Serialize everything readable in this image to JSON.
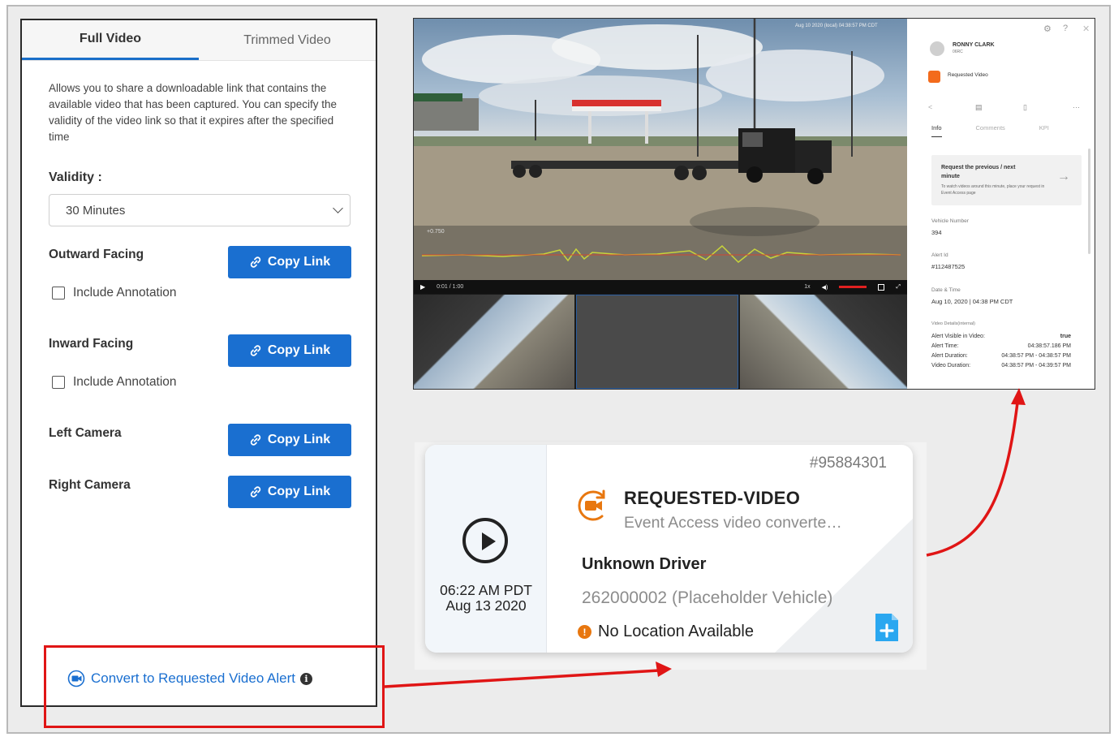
{
  "share_panel": {
    "tabs": [
      {
        "label": "Full Video",
        "active": true
      },
      {
        "label": "Trimmed Video",
        "active": false
      }
    ],
    "description": "Allows you to share a downloadable link that contains the available video that has been captured. You can specify the validity of the video link so that it expires after the specified time",
    "validity_label": "Validity :",
    "validity_value": "30 Minutes",
    "cameras": [
      {
        "label": "Outward Facing",
        "button": "Copy Link",
        "annotation": "Include Annotation"
      },
      {
        "label": "Inward Facing",
        "button": "Copy Link",
        "annotation": "Include Annotation"
      },
      {
        "label": "Left Camera",
        "button": "Copy Link"
      },
      {
        "label": "Right Camera",
        "button": "Copy Link"
      }
    ],
    "convert_link": "Convert to Requested Video Alert",
    "accent_color": "#1a6fd0",
    "highlight_color": "#e01515"
  },
  "viewer": {
    "timestamp_overlay": "Aug 10 2020 (local) 04:38:57 PM CDT",
    "gsensor_label": "+0.750",
    "player_time": "0:01 / 1:00",
    "speed": "1x",
    "details": {
      "user_name": "RONNY CLARK",
      "user_sub": "06RC",
      "event_type": "Requested Video",
      "tabs": [
        "Info",
        "Comments",
        "KPI"
      ],
      "request_title": "Request the previous / next minute",
      "request_note": "To watch videos around this minute, place your request in Event Access page",
      "vehicle_number_label": "Vehicle Number",
      "vehicle_number": "394",
      "alert_id_label": "Alert Id",
      "alert_id": "#112487525",
      "date_time_label": "Date & Time",
      "date_time": "Aug 10, 2020 | 04:38 PM CDT",
      "video_details_label": "Video Details(internal)",
      "video_details": [
        {
          "k": "Alert Visible in Video:",
          "v": "true"
        },
        {
          "k": "Alert Time:",
          "v": "04:38:57.186 PM"
        },
        {
          "k": "Alert Duration:",
          "v": "04:38:57 PM - 04:38:57 PM"
        },
        {
          "k": "Video Duration:",
          "v": "04:38:57 PM - 04:39:57 PM"
        }
      ]
    }
  },
  "alert_card": {
    "id": "#95884301",
    "title": "REQUESTED-VIDEO",
    "subtitle": "Event Access video converte…",
    "driver": "Unknown Driver",
    "vehicle": "262000002 (Placeholder Vehicle)",
    "location": "No Location Available",
    "time": "06:22 AM PDT",
    "date": "Aug 13 2020",
    "icon_color": "#e8770f"
  }
}
